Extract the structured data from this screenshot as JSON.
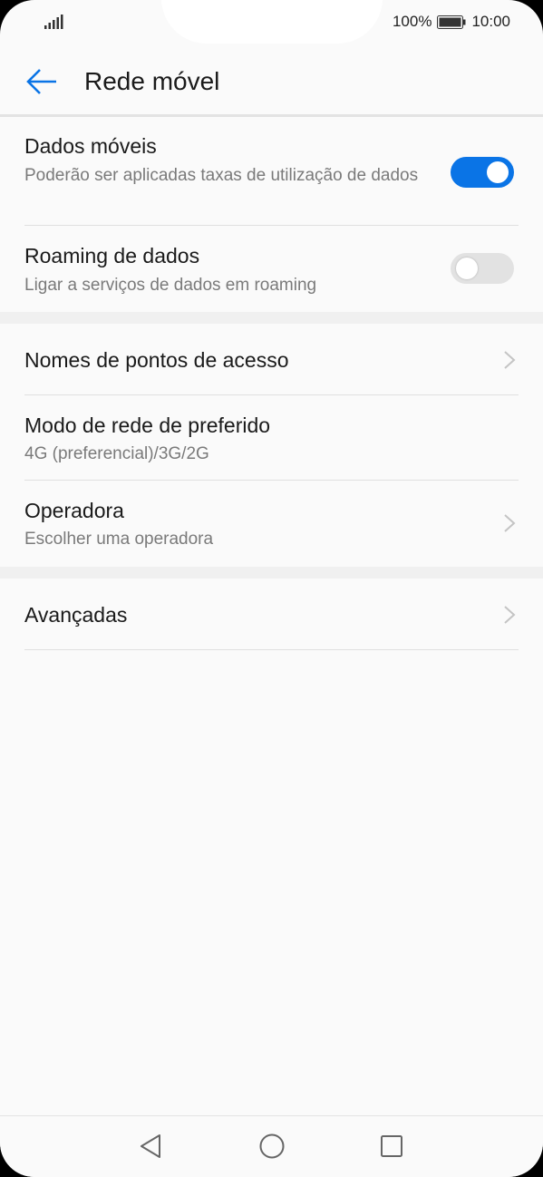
{
  "status": {
    "battery_percent": "100%",
    "time": "10:00"
  },
  "header": {
    "title": "Rede móvel"
  },
  "rows": {
    "mobile_data": {
      "title": "Dados móveis",
      "subtitle": "Poderão ser aplicadas taxas de utilização de dados",
      "enabled": true
    },
    "roaming": {
      "title": "Roaming de dados",
      "subtitle": "Ligar a serviços de dados em roaming",
      "enabled": false
    },
    "apn": {
      "title": "Nomes de pontos de acesso"
    },
    "network_mode": {
      "title": "Modo de rede de preferido",
      "subtitle": "4G (preferencial)/3G/2G"
    },
    "carrier": {
      "title": "Operadora",
      "subtitle": "Escolher uma operadora"
    },
    "advanced": {
      "title": "Avançadas"
    }
  },
  "colors": {
    "accent": "#0a74e6",
    "toggle_off": "#e2e2e2",
    "background": "#fafafa"
  },
  "icons": {
    "back": "arrow-left-icon",
    "chevron": "chevron-right-icon",
    "nav_back": "triangle-back-icon",
    "nav_home": "circle-home-icon",
    "nav_recents": "square-recents-icon"
  }
}
